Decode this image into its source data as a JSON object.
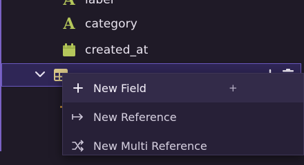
{
  "colors": {
    "background": "#1f1a27",
    "accent": "#7a62c4",
    "field_icon": "#b5c75b",
    "table_icon": "#d9c789"
  },
  "tree": {
    "fields": [
      {
        "label": "label",
        "icon": "text-type-icon"
      },
      {
        "label": "category",
        "icon": "text-type-icon"
      },
      {
        "label": "created_at",
        "icon": "calendar-icon"
      }
    ],
    "selected_row": {
      "icon": "table-icon",
      "expanded": true,
      "actions": [
        "add-icon",
        "trash-icon"
      ]
    }
  },
  "context_menu": {
    "items": [
      {
        "label": "New Field",
        "icon": "plus-icon",
        "shortcut": "+",
        "active": true
      },
      {
        "label": "New Reference",
        "icon": "arrow-right-icon",
        "shortcut": "",
        "active": false
      },
      {
        "label": "New Multi Reference",
        "icon": "shuffle-icon",
        "shortcut": "",
        "active": false
      }
    ]
  }
}
